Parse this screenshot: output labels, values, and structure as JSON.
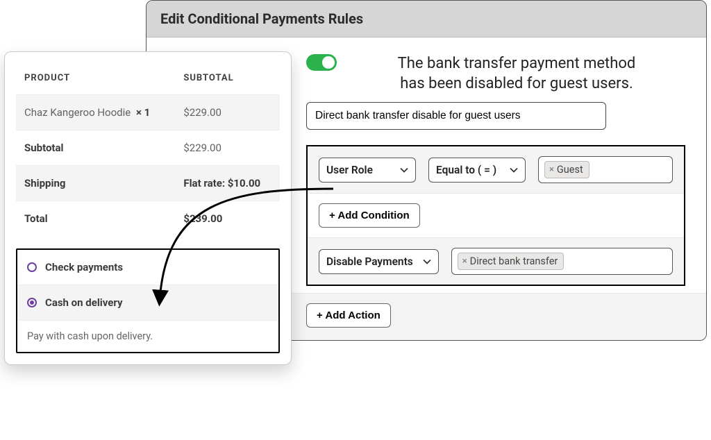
{
  "panel": {
    "title": "Edit Conditional Payments Rules",
    "toggle_on": true,
    "headline_line1": "The bank transfer payment method",
    "headline_line2": "has been disabled for guest users.",
    "rule_name": "Direct bank transfer disable for guest users",
    "condition": {
      "field": "User Role",
      "operator": "Equal to ( = )",
      "value_tag": "Guest"
    },
    "add_condition_label": "+ Add Condition",
    "action": {
      "type": "Disable Payments",
      "value_tag": "Direct bank transfer"
    },
    "add_action_label": "+ Add Action"
  },
  "checkout": {
    "col_product": "PRODUCT",
    "col_subtotal": "SUBTOTAL",
    "item_name": "Chaz Kangeroo Hoodie",
    "item_qty": "× 1",
    "item_price": "$229.00",
    "subtotal_label": "Subtotal",
    "subtotal_value": "$229.00",
    "shipping_label": "Shipping",
    "shipping_value": "Flat rate: $10.00",
    "total_label": "Total",
    "total_value": "$239.00",
    "payments": [
      {
        "label": "Check payments",
        "selected": false
      },
      {
        "label": "Cash on delivery",
        "selected": true
      }
    ],
    "selected_desc": "Pay with cash upon delivery."
  }
}
